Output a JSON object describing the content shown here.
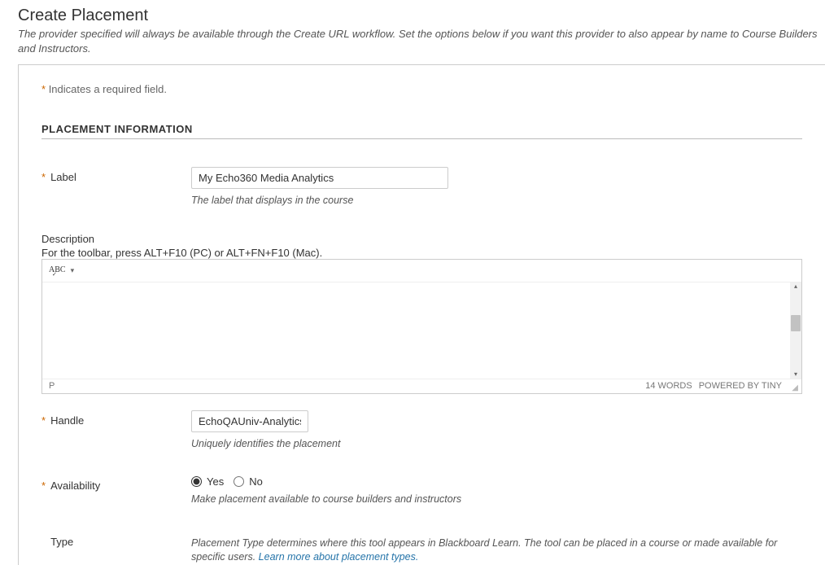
{
  "header": {
    "title": "Create Placement",
    "subtitle": "The provider specified will always be available through the Create URL workflow. Set the options below if you want this provider to also appear by name to Course Builders and Instructors."
  },
  "required_note": "Indicates a required field.",
  "section": "PLACEMENT INFORMATION",
  "fields": {
    "label": {
      "name": "Label",
      "value": "My Echo360 Media Analytics",
      "helper": "The label that displays in the course"
    },
    "description": {
      "name": "Description",
      "toolbar_hint": "For the toolbar, press ALT+F10 (PC) or ALT+FN+F10 (Mac).",
      "status_path": "P",
      "word_count": "14 WORDS",
      "powered": "POWERED BY TINY"
    },
    "handle": {
      "name": "Handle",
      "value": "EchoQAUniv-Analytics",
      "helper": "Uniquely identifies the placement"
    },
    "availability": {
      "name": "Availability",
      "options": {
        "yes": "Yes",
        "no": "No"
      },
      "selected": "yes",
      "helper": "Make placement available to course builders and instructors"
    },
    "type": {
      "name": "Type",
      "helper_pre": "Placement Type determines where this tool appears in Blackboard Learn. The tool can be placed in a course or made available for specific users. ",
      "link": "Learn more about placement types."
    }
  }
}
